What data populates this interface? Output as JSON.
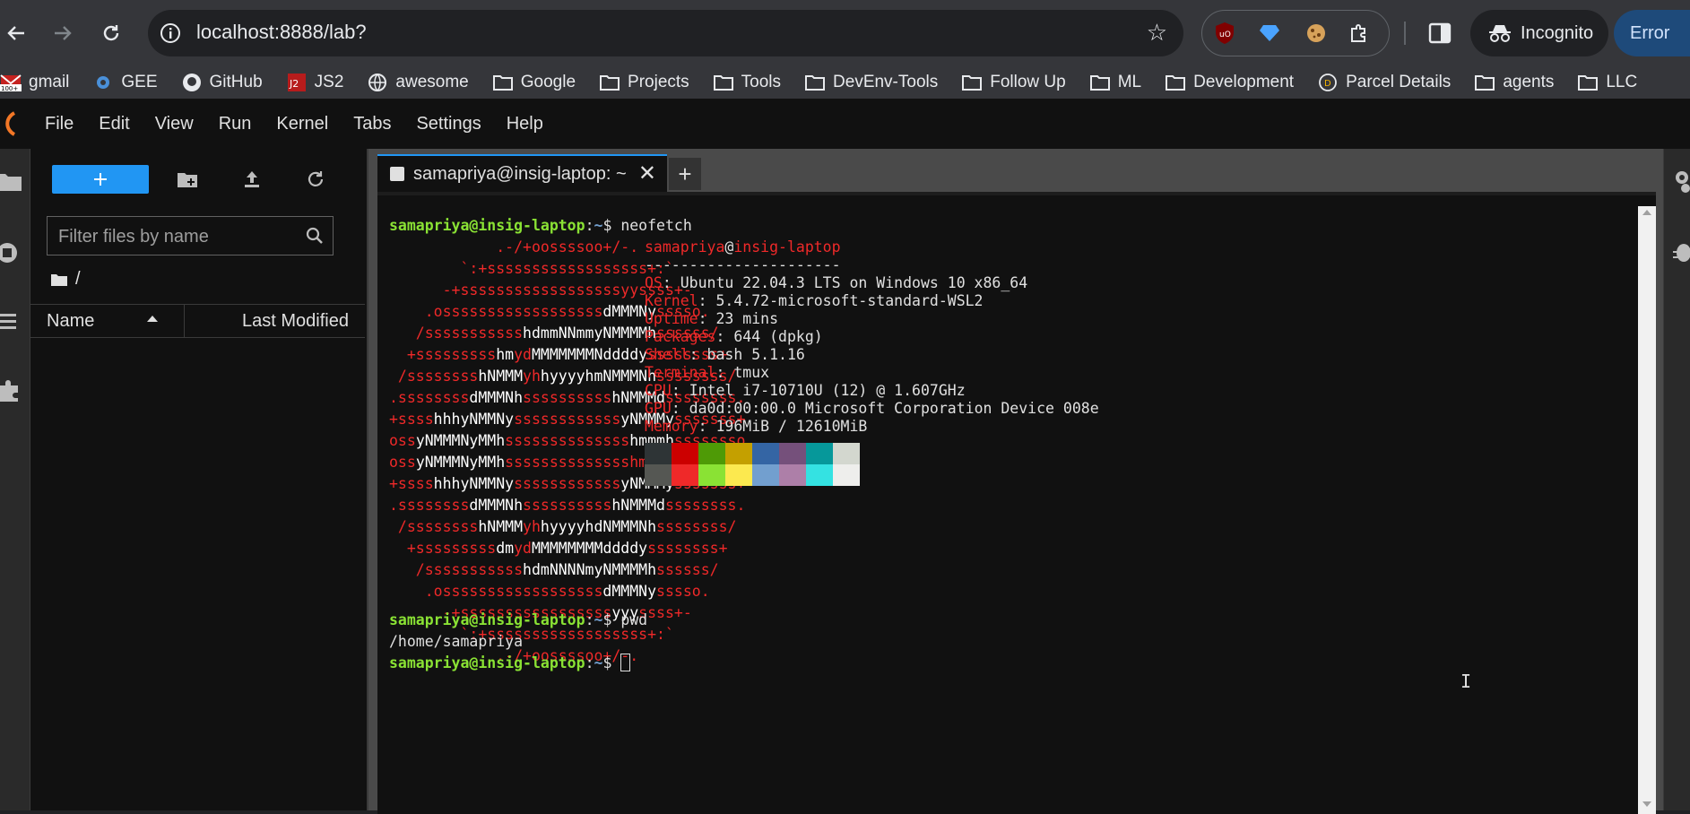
{
  "browser": {
    "url": "localhost:8888/lab?",
    "incognito_label": "Incognito",
    "error_label": "Error"
  },
  "bookmarks": [
    {
      "label": "gmail",
      "icon": "gmail-icon"
    },
    {
      "label": "GEE",
      "icon": "gear-icon"
    },
    {
      "label": "GitHub",
      "icon": "github-icon"
    },
    {
      "label": "JS2",
      "icon": "js2-icon"
    },
    {
      "label": "awesome",
      "icon": "globe-icon"
    },
    {
      "label": "Google",
      "icon": "folder-icon"
    },
    {
      "label": "Projects",
      "icon": "folder-icon"
    },
    {
      "label": "Tools",
      "icon": "folder-icon"
    },
    {
      "label": "DevEnv-Tools",
      "icon": "folder-icon"
    },
    {
      "label": "Follow Up",
      "icon": "folder-icon"
    },
    {
      "label": "ML",
      "icon": "folder-icon"
    },
    {
      "label": "Development",
      "icon": "folder-icon"
    },
    {
      "label": "Parcel Details",
      "icon": "parcel-icon"
    },
    {
      "label": "agents",
      "icon": "folder-icon"
    },
    {
      "label": "LLC",
      "icon": "folder-icon"
    }
  ],
  "menu": [
    "File",
    "Edit",
    "View",
    "Run",
    "Kernel",
    "Tabs",
    "Settings",
    "Help"
  ],
  "filebrowser": {
    "filter_placeholder": "Filter files by name",
    "breadcrumb": "/",
    "col_name": "Name",
    "col_modified": "Last Modified"
  },
  "tab": {
    "label": "samapriya@insig-laptop: ~"
  },
  "terminal": {
    "user": "samapriya",
    "at": "@",
    "host": "insig-laptop",
    "prompt_sep": ":",
    "prompt_path": "~",
    "prompt_dollar": "$ ",
    "cmd1": "neofetch",
    "dashes": "----------------------",
    "info": [
      {
        "key": "OS",
        "value": ": Ubuntu 22.04.3 LTS on Windows 10 x86_64"
      },
      {
        "key": "Kernel",
        "value": ": 5.4.72-microsoft-standard-WSL2"
      },
      {
        "key": "Uptime",
        "value": ": 23 mins"
      },
      {
        "key": "Packages",
        "value": ": 644 (dpkg)"
      },
      {
        "key": "Shell",
        "value": ": bash 5.1.16"
      },
      {
        "key": "Terminal",
        "value": ": tmux"
      },
      {
        "key": "CPU",
        "value": ": Intel i7-10710U (12) @ 1.607GHz"
      },
      {
        "key": "GPU",
        "value": ": da0d:00:00.0 Microsoft Corporation Device 008e"
      },
      {
        "key": "Memory",
        "value": ": 196MiB / 12610MiB"
      }
    ],
    "cmd2": "pwd",
    "pwd_output": "/home/samapriya",
    "palette_row1": [
      "#2e3436",
      "#cc0000",
      "#4e9a06",
      "#c4a000",
      "#3465a4",
      "#75507b",
      "#06989a",
      "#d3d7cf"
    ],
    "palette_row2": [
      "#555753",
      "#ef2929",
      "#8ae234",
      "#fce94f",
      "#729fcf",
      "#ad7fa8",
      "#34e2e2",
      "#eeeeec"
    ]
  }
}
